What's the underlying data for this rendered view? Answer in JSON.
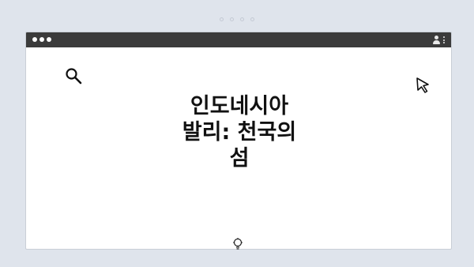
{
  "headline": {
    "line1": "인도네시아",
    "line2": "발리: 천국의",
    "line3": "섬"
  },
  "icons": {
    "search": "search-icon",
    "cursor": "cursor-arrow-icon",
    "idea": "lightbulb-icon",
    "profile": "profile-icon",
    "menu": "kebab-menu-icon"
  },
  "colors": {
    "titlebar": "#3b3b3b",
    "page_background": "#dfe4ec",
    "window_background": "#ffffff",
    "headline": "#111111"
  }
}
